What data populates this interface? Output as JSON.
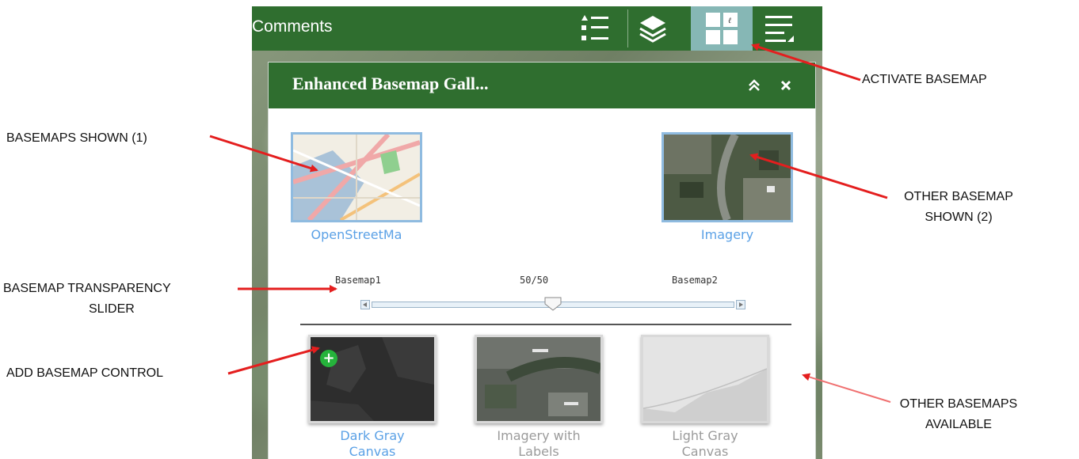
{
  "app": {
    "topbar_title": "Comments",
    "toolbar_icons": [
      "list-icon",
      "layers-icon",
      "basemap-gallery-icon",
      "menu-icon"
    ],
    "active_tool": "basemap-gallery-icon",
    "accent_color": "#2f6e2f"
  },
  "panel": {
    "title": "Enhanced Basemap Gall...",
    "collapse_icon": "chevron-double-up-icon",
    "close_icon": "close-icon",
    "shown_basemaps": [
      {
        "caption": "OpenStreetMa"
      },
      {
        "caption": "Imagery"
      }
    ],
    "slider": {
      "left_label": "Basemap1",
      "value_label": "50/50",
      "right_label": "Basemap2",
      "value": 0.5
    },
    "available_basemaps": [
      {
        "caption_line1": "Dark Gray",
        "caption_line2": "Canvas",
        "add_control": "+"
      },
      {
        "caption_line1": "Imagery with",
        "caption_line2": "Labels"
      },
      {
        "caption_line1": "Light Gray",
        "caption_line2": "Canvas"
      }
    ]
  },
  "annotations": {
    "activate_basemap": "ACTIVATE BASEMAP",
    "basemaps_shown": "BASEMAPS SHOWN (1)",
    "other_basemap_shown_line1": "OTHER BASEMAP",
    "other_basemap_shown_line2": "SHOWN (2)",
    "transparency_line1": "BASEMAP TRANSPARENCY",
    "transparency_line2": "SLIDER",
    "add_control": "ADD BASEMAP CONTROL",
    "other_available_line1": "OTHER BASEMAPS",
    "other_available_line2": "AVAILABLE",
    "arrow_color": "#e41e1e"
  }
}
